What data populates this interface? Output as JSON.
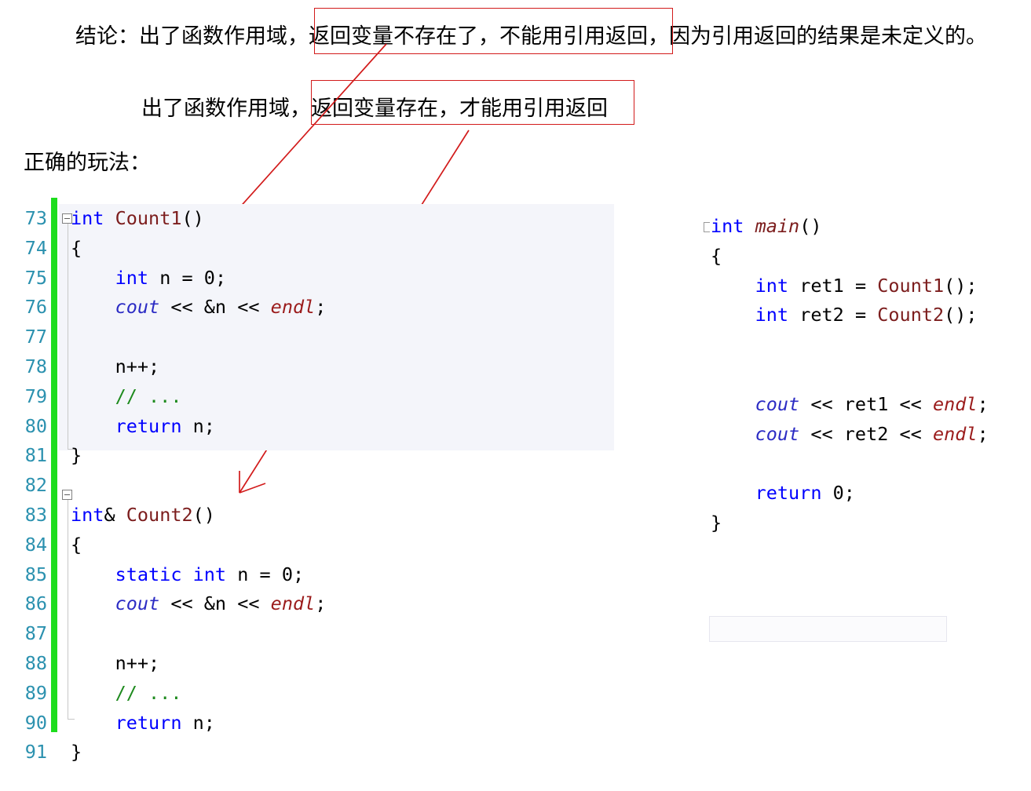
{
  "document": {
    "prose": {
      "line1": "结论：出了函数作用域，返回变量不存在了，不能用引用返回，因为引用返回的结果是未定义的。",
      "line2": "出了函数作用域，返回变量存在，才能用引用返回",
      "line3": "正确的玩法："
    },
    "annotations": {
      "box1_label": "返回变量不存在了，不能用引用返回",
      "box2_label": "出了函数作用域，返回变量存在，才能用引用返回",
      "box_color": "#d21b1b",
      "arrow1_target": "Count1()",
      "arrow2_target": "Count2()"
    }
  },
  "editor_left": {
    "changebar_color": "#1ddd1d",
    "selection_color": "#f4f5fa",
    "line_numbers": [
      "73",
      "74",
      "75",
      "76",
      "77",
      "78",
      "79",
      "80",
      "81",
      "82",
      "83",
      "84",
      "85",
      "86",
      "87",
      "88",
      "89",
      "90",
      "91"
    ],
    "lines": [
      "int Count1()",
      "{",
      "    int n = 0;",
      "    cout << &n << endl;",
      "",
      "    n++;",
      "    // ...",
      "    return n;",
      "}",
      "",
      "int& Count2()",
      "{",
      "    static int n = 0;",
      "    cout << &n << endl;",
      "",
      "    n++;",
      "    // ...",
      "    return n;",
      "}"
    ]
  },
  "editor_right": {
    "lines": [
      "int main()",
      "{",
      "    int ret1 = Count1();",
      "    int ret2 = Count2();",
      "",
      "",
      "    cout << ret1 << endl;",
      "    cout << ret2 << endl;",
      "",
      "    return 0;",
      "}"
    ],
    "current_line_index": 7
  },
  "theme": {
    "keyword": "#0000ff",
    "function": "#7c1d1d",
    "stream": "#2b2bc4",
    "manipulator": "#9b1c1c",
    "comment": "#1d8a1d",
    "linenumber": "#2b91af"
  }
}
